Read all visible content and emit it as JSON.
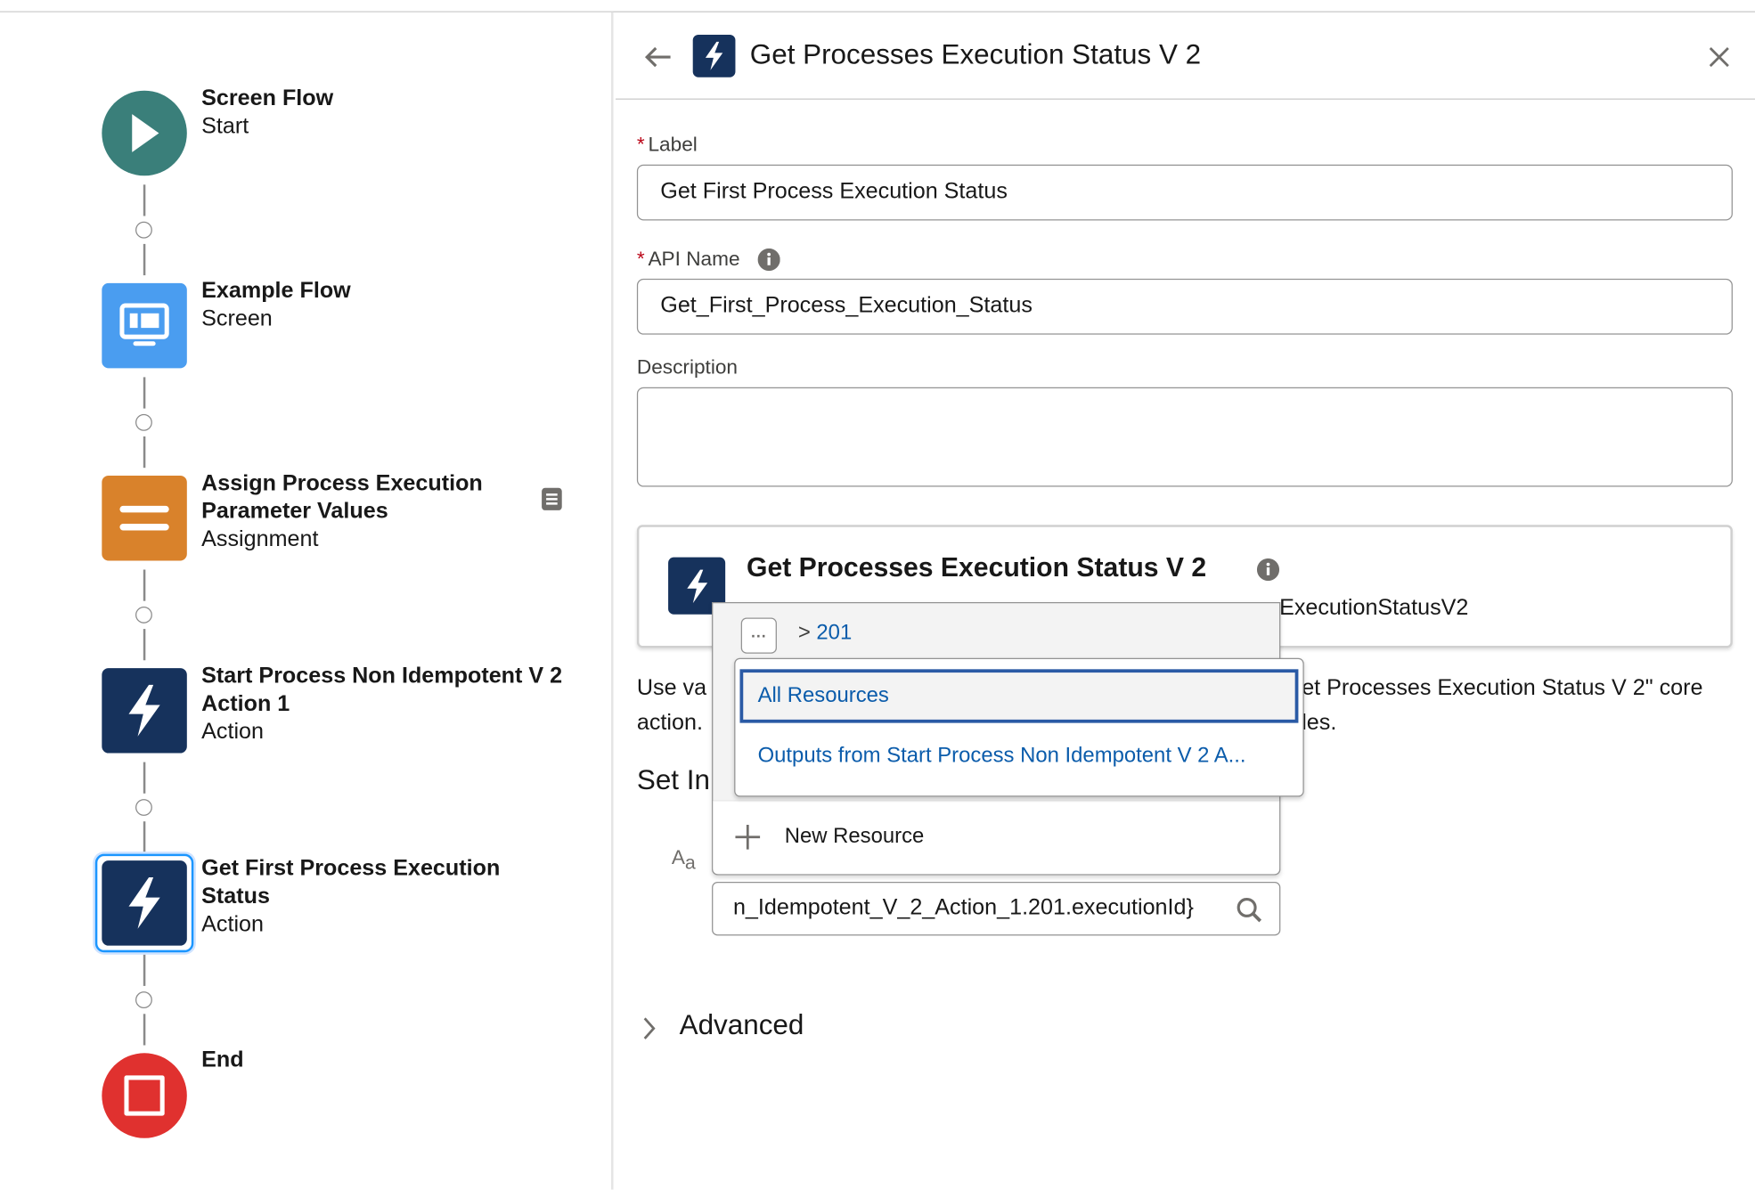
{
  "flow": {
    "nodes": [
      {
        "title": "Screen Flow",
        "type": "Start",
        "icon": "play-icon",
        "color": "#3a7f7a"
      },
      {
        "title": "Example Flow",
        "type": "Screen",
        "icon": "screen-icon",
        "color": "#4a9df0"
      },
      {
        "title": "Assign Process Execution Parameter Values",
        "type": "Assignment",
        "icon": "assignment-icon",
        "color": "#d9822b"
      },
      {
        "title": "Start Process Non Idempotent V 2 Action 1",
        "type": "Action",
        "icon": "lightning-icon",
        "color": "#16325c"
      },
      {
        "title": "Get First Process Execution Status",
        "type": "Action",
        "icon": "lightning-icon",
        "color": "#16325c",
        "selected": true
      },
      {
        "title": "End",
        "type": "",
        "icon": "stop-icon",
        "color": "#e0312f"
      }
    ]
  },
  "panel": {
    "title": "Get Processes Execution Status V 2",
    "label_label": "Label",
    "label_value": "Get First Process Execution Status",
    "api_label": "API Name",
    "api_value": "Get_First_Process_Execution_Status",
    "description_label": "Description",
    "description_value": "",
    "card_title": "Get Processes Execution Status V 2",
    "card_sub_visible": "ExecutionStatusV2",
    "help_left_1": "Use va",
    "help_right_1": "et Processes Execution Status V 2\" core",
    "help_left_2": "action.",
    "help_right_2": "les.",
    "set_inputs_partial": "Set In",
    "type_icon_label": "Aa",
    "input_value": "n_Idempotent_V_2_Action_1.201.executionId}",
    "advanced": "Advanced"
  },
  "dropdown": {
    "breadcrumb_sep": ">",
    "breadcrumb": "201",
    "items": [
      "All Resources",
      "Outputs from Start Process Non Idempotent V 2 A..."
    ],
    "new_resource": "New Resource"
  }
}
